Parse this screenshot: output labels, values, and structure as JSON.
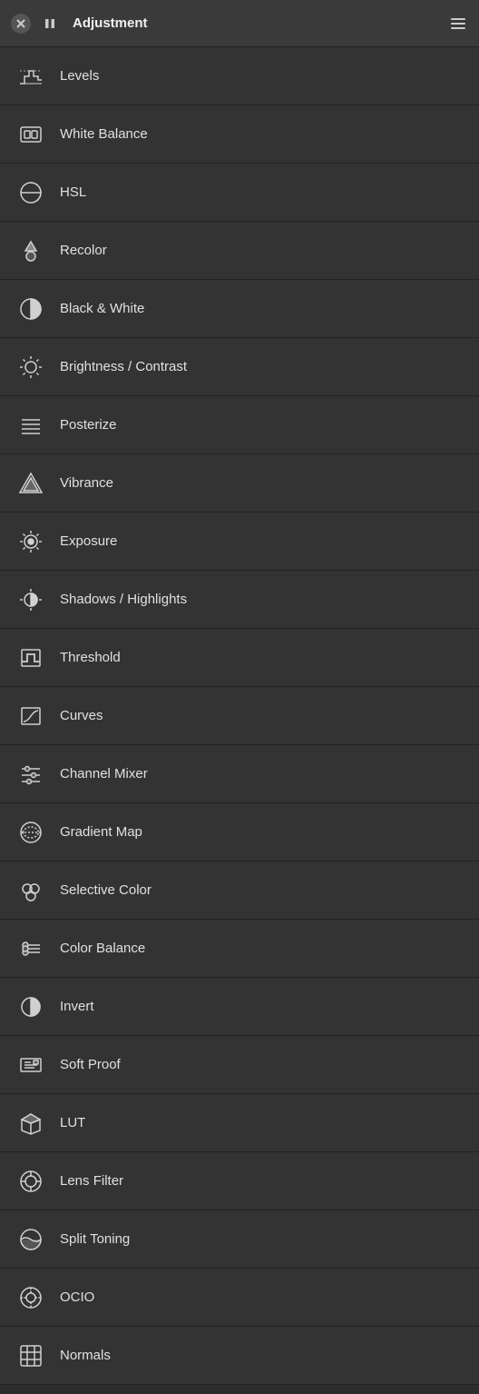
{
  "header": {
    "title": "Adjustment",
    "close_label": "close",
    "pause_label": "pause",
    "menu_label": "menu"
  },
  "items": [
    {
      "id": "levels",
      "label": "Levels",
      "icon": "levels-icon"
    },
    {
      "id": "white-balance",
      "label": "White Balance",
      "icon": "white-balance-icon"
    },
    {
      "id": "hsl",
      "label": "HSL",
      "icon": "hsl-icon"
    },
    {
      "id": "recolor",
      "label": "Recolor",
      "icon": "recolor-icon"
    },
    {
      "id": "black-white",
      "label": "Black & White",
      "icon": "black-white-icon"
    },
    {
      "id": "brightness-contrast",
      "label": "Brightness / Contrast",
      "icon": "brightness-contrast-icon"
    },
    {
      "id": "posterize",
      "label": "Posterize",
      "icon": "posterize-icon"
    },
    {
      "id": "vibrance",
      "label": "Vibrance",
      "icon": "vibrance-icon"
    },
    {
      "id": "exposure",
      "label": "Exposure",
      "icon": "exposure-icon"
    },
    {
      "id": "shadows-highlights",
      "label": "Shadows / Highlights",
      "icon": "shadows-highlights-icon"
    },
    {
      "id": "threshold",
      "label": "Threshold",
      "icon": "threshold-icon"
    },
    {
      "id": "curves",
      "label": "Curves",
      "icon": "curves-icon"
    },
    {
      "id": "channel-mixer",
      "label": "Channel Mixer",
      "icon": "channel-mixer-icon"
    },
    {
      "id": "gradient-map",
      "label": "Gradient Map",
      "icon": "gradient-map-icon"
    },
    {
      "id": "selective-color",
      "label": "Selective Color",
      "icon": "selective-color-icon"
    },
    {
      "id": "color-balance",
      "label": "Color Balance",
      "icon": "color-balance-icon"
    },
    {
      "id": "invert",
      "label": "Invert",
      "icon": "invert-icon"
    },
    {
      "id": "soft-proof",
      "label": "Soft Proof",
      "icon": "soft-proof-icon"
    },
    {
      "id": "lut",
      "label": "LUT",
      "icon": "lut-icon"
    },
    {
      "id": "lens-filter",
      "label": "Lens Filter",
      "icon": "lens-filter-icon"
    },
    {
      "id": "split-toning",
      "label": "Split Toning",
      "icon": "split-toning-icon"
    },
    {
      "id": "ocio",
      "label": "OCIO",
      "icon": "ocio-icon"
    },
    {
      "id": "normals",
      "label": "Normals",
      "icon": "normals-icon"
    }
  ]
}
